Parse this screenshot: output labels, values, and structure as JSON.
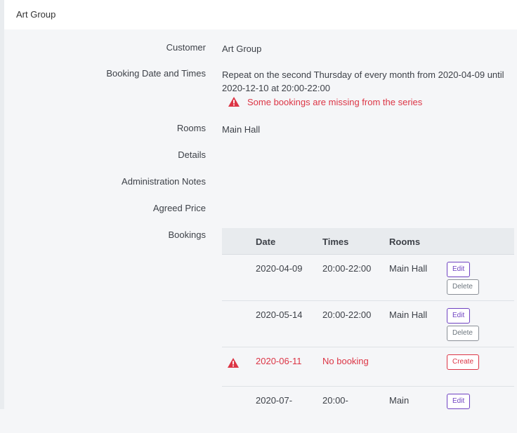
{
  "header": {
    "title": "Art Group"
  },
  "fields": {
    "customer": {
      "label": "Customer",
      "value": "Art Group"
    },
    "booking_dates": {
      "label": "Booking Date and Times",
      "value": "Repeat on the second Thursday of every month from 2020-04-09 until 2020-12-10 at 20:00-22:00",
      "warning": "Some bookings are missing from the series"
    },
    "rooms": {
      "label": "Rooms",
      "value": "Main Hall"
    },
    "details": {
      "label": "Details",
      "value": ""
    },
    "admin_notes": {
      "label": "Administration Notes",
      "value": ""
    },
    "agreed_price": {
      "label": "Agreed Price",
      "value": ""
    },
    "bookings": {
      "label": "Bookings"
    }
  },
  "bookings_table": {
    "headers": {
      "date": "Date",
      "times": "Times",
      "rooms": "Rooms"
    },
    "rows": [
      {
        "date": "2020-04-09",
        "times": "20:00-22:00",
        "rooms": "Main Hall",
        "edit": "Edit",
        "delete": "Delete"
      },
      {
        "date": "2020-05-14",
        "times": "20:00-22:00",
        "rooms": "Main Hall",
        "edit": "Edit",
        "delete": "Delete"
      },
      {
        "date": "2020-06-11",
        "times": "No booking",
        "create": "Create",
        "missing": true
      },
      {
        "date": "2020-07-",
        "times": "20:00-",
        "rooms": "Main",
        "edit": "Edit"
      }
    ]
  },
  "colors": {
    "warning": "#dc3545",
    "edit": "#6f42c1",
    "header_bg": "#ffffff",
    "page_bg": "#f5f6f8"
  }
}
